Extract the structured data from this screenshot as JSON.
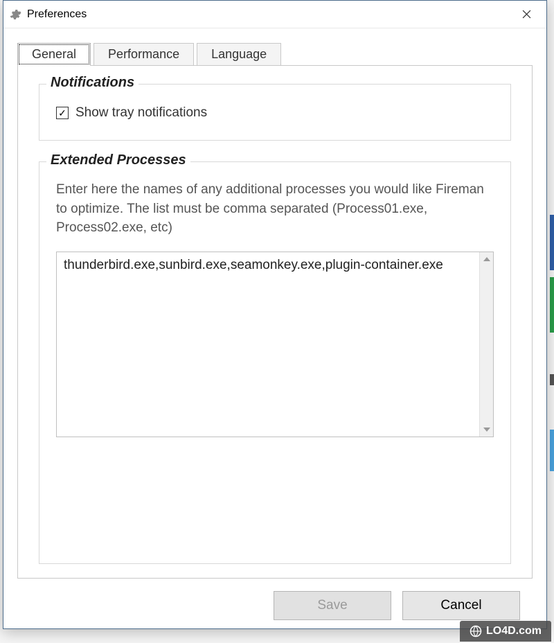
{
  "window": {
    "title": "Preferences"
  },
  "tabs": {
    "general": "General",
    "performance": "Performance",
    "language": "Language"
  },
  "notifications": {
    "legend": "Notifications",
    "show_tray_label": "Show tray notifications",
    "show_tray_checked": "✓"
  },
  "extended": {
    "legend": "Extended Processes",
    "help": "Enter here the names of any additional processes you would like Fireman to optimize. The list must be comma separated (Process01.exe, Process02.exe, etc)",
    "value": "thunderbird.exe,sunbird.exe,seamonkey.exe,plugin-container.exe"
  },
  "buttons": {
    "save": "Save",
    "cancel": "Cancel"
  },
  "watermark": "LO4D.com"
}
